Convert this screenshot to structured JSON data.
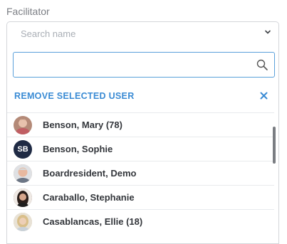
{
  "field": {
    "label": "Facilitator",
    "placeholder": "Search name"
  },
  "dropdown": {
    "search_value": "",
    "remove_label": "REMOVE SELECTED USER",
    "users": [
      {
        "name": "Benson, Mary (78)",
        "avatar": "photo",
        "bg": "#b48a78"
      },
      {
        "name": "Benson, Sophie",
        "avatar": "initials",
        "initials": "SB",
        "bg": "#1f2a44"
      },
      {
        "name": "Boardresident, Demo",
        "avatar": "photo",
        "bg": "#caa48d"
      },
      {
        "name": "Caraballo, Stephanie",
        "avatar": "photo",
        "bg": "#5a4036"
      },
      {
        "name": "Casablancas, Ellie (18)",
        "avatar": "photo",
        "bg": "#d8c7a6"
      }
    ]
  }
}
